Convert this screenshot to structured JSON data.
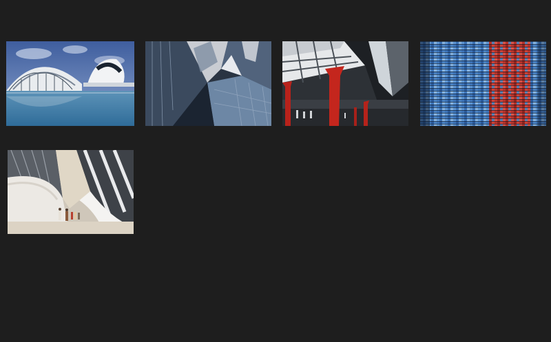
{
  "gallery": {
    "background": "#1e1e1e",
    "thumbnails": [
      {
        "subject": "curved-white-building-over-water-photo"
      },
      {
        "subject": "glass-steel-skyscraper-facade-photo"
      },
      {
        "subject": "red-pillar-station-canopy-photo"
      },
      {
        "subject": "mosaic-glass-tower-photo"
      },
      {
        "subject": "white-curved-interior-hall-photo"
      }
    ]
  }
}
